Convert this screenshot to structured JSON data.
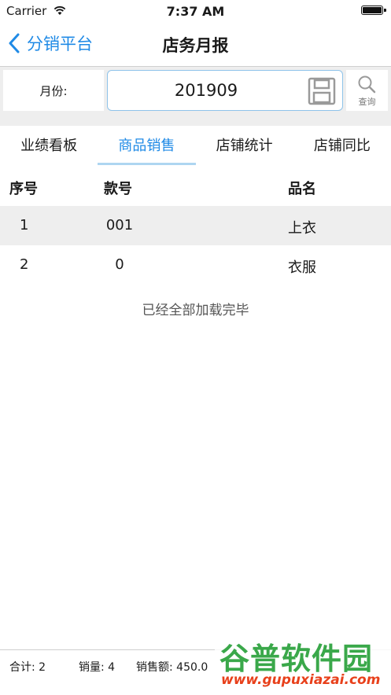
{
  "status_bar": {
    "carrier": "Carrier",
    "time": "7:37 AM"
  },
  "nav": {
    "back_label": "分销平台",
    "title": "店务月报"
  },
  "month": {
    "label": "月份:",
    "value": "201909",
    "search_label": "查询"
  },
  "tabs": [
    {
      "label": "业绩看板",
      "active": false
    },
    {
      "label": "商品销售",
      "active": true
    },
    {
      "label": "店铺统计",
      "active": false
    },
    {
      "label": "店铺同比",
      "active": false
    }
  ],
  "table": {
    "headers": [
      "序号",
      "款号",
      "品名"
    ],
    "rows": [
      {
        "index": "1",
        "code": "001",
        "name": "上衣"
      },
      {
        "index": "2",
        "code": "0",
        "name": "衣服"
      }
    ]
  },
  "load_status": "已经全部加载完毕",
  "footer": {
    "total": "合计: 2",
    "qty": "销量: 4",
    "amount": "销售额: 450.0"
  },
  "watermark": {
    "brand": "谷普软件园",
    "url": "www.gupuxiazai.com"
  },
  "colors": {
    "accent": "#1f8ae6",
    "tab_underline": "#aed6f1",
    "stripe": "#eeeeee"
  }
}
